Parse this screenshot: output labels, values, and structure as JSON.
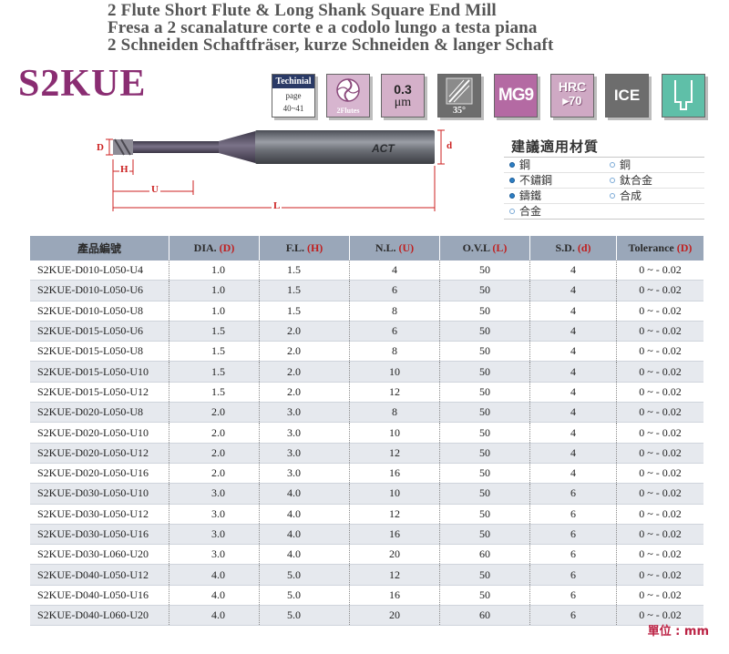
{
  "titles": {
    "en": "2 Flute Short Flute & Long Shank Square End Mill",
    "it": "Fresa a 2 scanalature corte e a codolo lungo a testa piana",
    "de": "2 Schneiden Schaftfräser, kurze Schneiden & langer Schaft"
  },
  "model": "S2KUE",
  "icons": {
    "technical": {
      "header": "Techinial",
      "page_label": "page",
      "page_range": "40~41"
    },
    "flutes": "2Flutes",
    "micron": {
      "value": "0.3",
      "unit": "μm"
    },
    "helix": "35°",
    "material": "MG9",
    "hrc": {
      "label": "HRC",
      "value": "▸70"
    },
    "coating": "ICE",
    "end_type_icon": "square-end-icon"
  },
  "drawing": {
    "labels": {
      "D": "D",
      "d": "d",
      "H": "H",
      "U": "U",
      "L": "L"
    },
    "brand": "ACT",
    "colors": {
      "dim": "#cc2222",
      "shank": "#6b6e75",
      "tip": "#9a9aa0"
    }
  },
  "materials": {
    "title": "建議適用材質",
    "rows": [
      [
        {
          "name": "鋼",
          "recommended": true
        },
        {
          "name": "銅",
          "recommended": false
        }
      ],
      [
        {
          "name": "不鏽鋼",
          "recommended": true
        },
        {
          "name": "鈦合金",
          "recommended": false
        }
      ],
      [
        {
          "name": "鑄鐵",
          "recommended": true
        },
        {
          "name": "合成",
          "recommended": false
        }
      ],
      [
        {
          "name": "合金",
          "recommended": false
        }
      ]
    ]
  },
  "table": {
    "headers": [
      {
        "text": "產品編號",
        "sym": ""
      },
      {
        "text": "DIA. ",
        "sym": "(D)"
      },
      {
        "text": "F.L. ",
        "sym": "(H)"
      },
      {
        "text": "N.L. ",
        "sym": "(U)"
      },
      {
        "text": "O.V.L ",
        "sym": "(L)"
      },
      {
        "text": "S.D. ",
        "sym": "(d)"
      },
      {
        "text": "Tolerance ",
        "sym": "(D)"
      }
    ],
    "rows": [
      [
        "S2KUE-D010-L050-U4",
        "1.0",
        "1.5",
        "4",
        "50",
        "4",
        "0 ~ - 0.02"
      ],
      [
        "S2KUE-D010-L050-U6",
        "1.0",
        "1.5",
        "6",
        "50",
        "4",
        "0 ~ - 0.02"
      ],
      [
        "S2KUE-D010-L050-U8",
        "1.0",
        "1.5",
        "8",
        "50",
        "4",
        "0 ~ - 0.02"
      ],
      [
        "S2KUE-D015-L050-U6",
        "1.5",
        "2.0",
        "6",
        "50",
        "4",
        "0 ~ - 0.02"
      ],
      [
        "S2KUE-D015-L050-U8",
        "1.5",
        "2.0",
        "8",
        "50",
        "4",
        "0 ~ - 0.02"
      ],
      [
        "S2KUE-D015-L050-U10",
        "1.5",
        "2.0",
        "10",
        "50",
        "4",
        "0 ~ - 0.02"
      ],
      [
        "S2KUE-D015-L050-U12",
        "1.5",
        "2.0",
        "12",
        "50",
        "4",
        "0 ~ - 0.02"
      ],
      [
        "S2KUE-D020-L050-U8",
        "2.0",
        "3.0",
        "8",
        "50",
        "4",
        "0 ~ - 0.02"
      ],
      [
        "S2KUE-D020-L050-U10",
        "2.0",
        "3.0",
        "10",
        "50",
        "4",
        "0 ~ - 0.02"
      ],
      [
        "S2KUE-D020-L050-U12",
        "2.0",
        "3.0",
        "12",
        "50",
        "4",
        "0 ~ - 0.02"
      ],
      [
        "S2KUE-D020-L050-U16",
        "2.0",
        "3.0",
        "16",
        "50",
        "4",
        "0 ~ - 0.02"
      ],
      [
        "S2KUE-D030-L050-U10",
        "3.0",
        "4.0",
        "10",
        "50",
        "6",
        "0 ~ - 0.02"
      ],
      [
        "S2KUE-D030-L050-U12",
        "3.0",
        "4.0",
        "12",
        "50",
        "6",
        "0 ~ - 0.02"
      ],
      [
        "S2KUE-D030-L050-U16",
        "3.0",
        "4.0",
        "16",
        "50",
        "6",
        "0 ~ - 0.02"
      ],
      [
        "S2KUE-D030-L060-U20",
        "3.0",
        "4.0",
        "20",
        "60",
        "6",
        "0 ~ - 0.02"
      ],
      [
        "S2KUE-D040-L050-U12",
        "4.0",
        "5.0",
        "12",
        "50",
        "6",
        "0 ~ - 0.02"
      ],
      [
        "S2KUE-D040-L050-U16",
        "4.0",
        "5.0",
        "16",
        "50",
        "6",
        "0 ~ - 0.02"
      ],
      [
        "S2KUE-D040-L060-U20",
        "4.0",
        "5.0",
        "20",
        "60",
        "6",
        "0 ~ - 0.02"
      ]
    ]
  },
  "unit": "單位 : mm",
  "colors": {
    "title": "#555555",
    "model": "#8a2d72",
    "header_bg": "#9aa7b9",
    "alt_row": "#e6e9ee",
    "accent_red": "#c02020"
  }
}
